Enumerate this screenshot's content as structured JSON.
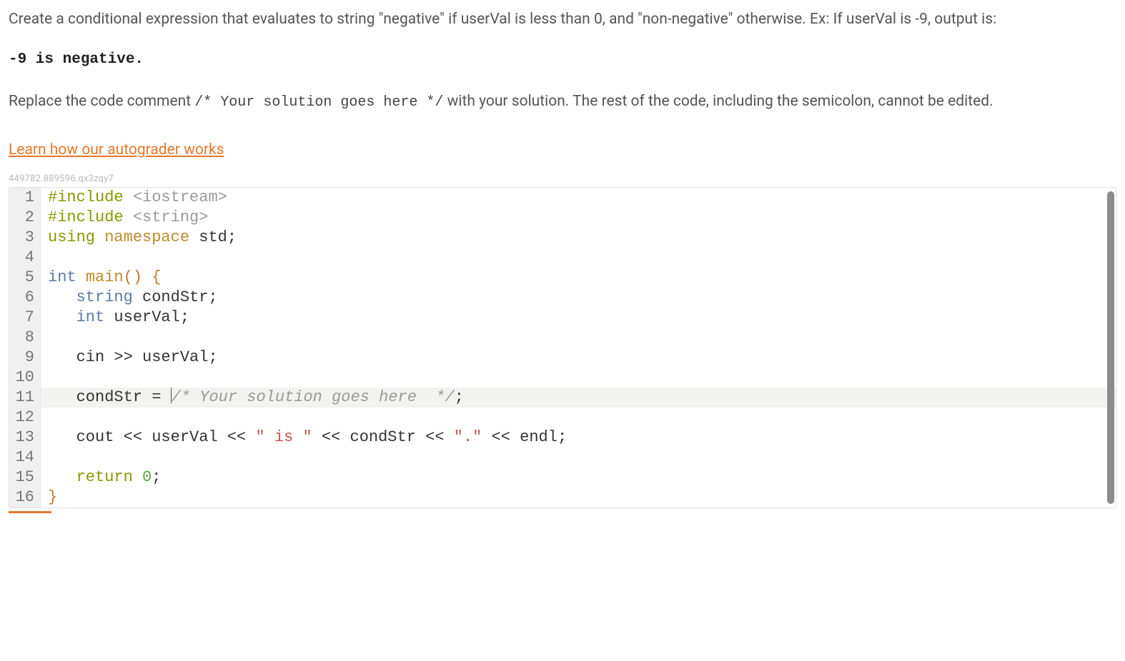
{
  "prompt": {
    "p1a": "Create a conditional expression that evaluates to string \"negative\" if userVal is less than 0, and \"non-negative\" otherwise. Ex: If userVal is -9, output is:",
    "sample": "-9 is negative.",
    "p2a": "Replace the code comment ",
    "p2code": "/* Your solution goes here */",
    "p2b": " with your solution. The rest of the code, including the semicolon, cannot be edited."
  },
  "link": {
    "label": "Learn how our autograder works"
  },
  "session_id": "449782.889596.qx3zqy7",
  "editor": {
    "highlight_line": 11,
    "lines": [
      {
        "n": 1,
        "tokens": [
          [
            "kw-pp",
            "#include "
          ],
          [
            "kw-inc",
            "<iostream>"
          ]
        ]
      },
      {
        "n": 2,
        "tokens": [
          [
            "kw-pp",
            "#include "
          ],
          [
            "kw-inc",
            "<string>"
          ]
        ]
      },
      {
        "n": 3,
        "tokens": [
          [
            "kw-pp",
            "using "
          ],
          [
            "kw-ns",
            "namespace "
          ],
          [
            "kw-id",
            "std"
          ],
          [
            "punct",
            ";"
          ]
        ]
      },
      {
        "n": 4,
        "tokens": [
          [
            "",
            ""
          ]
        ]
      },
      {
        "n": 5,
        "tokens": [
          [
            "kw-type",
            "int "
          ],
          [
            "kw-min",
            "main"
          ],
          [
            "paren",
            "()"
          ],
          [
            "",
            " "
          ],
          [
            "brace",
            "{"
          ]
        ]
      },
      {
        "n": 6,
        "tokens": [
          [
            "",
            "   "
          ],
          [
            "kw-str",
            "string "
          ],
          [
            "kw-id",
            "condStr"
          ],
          [
            "punct",
            ";"
          ]
        ]
      },
      {
        "n": 7,
        "tokens": [
          [
            "",
            "   "
          ],
          [
            "kw-type",
            "int "
          ],
          [
            "kw-id",
            "userVal"
          ],
          [
            "punct",
            ";"
          ]
        ]
      },
      {
        "n": 8,
        "tokens": [
          [
            "",
            ""
          ]
        ]
      },
      {
        "n": 9,
        "tokens": [
          [
            "",
            "   "
          ],
          [
            "kw-id",
            "cin "
          ],
          [
            "kw-op",
            ">> "
          ],
          [
            "kw-id",
            "userVal"
          ],
          [
            "punct",
            ";"
          ]
        ]
      },
      {
        "n": 10,
        "tokens": [
          [
            "",
            ""
          ]
        ]
      },
      {
        "n": 11,
        "tokens": [
          [
            "",
            "   "
          ],
          [
            "kw-id",
            "condStr "
          ],
          [
            "kw-op",
            "= "
          ],
          [
            "caret",
            ""
          ],
          [
            "kw-cmt",
            "/* Your solution goes here  */"
          ],
          [
            "punct",
            ";"
          ]
        ]
      },
      {
        "n": 12,
        "tokens": [
          [
            "",
            ""
          ]
        ]
      },
      {
        "n": 13,
        "tokens": [
          [
            "",
            "   "
          ],
          [
            "kw-id",
            "cout "
          ],
          [
            "kw-op",
            "<< "
          ],
          [
            "kw-id",
            "userVal "
          ],
          [
            "kw-op",
            "<< "
          ],
          [
            "kw-str2",
            "\" is \""
          ],
          [
            "",
            " "
          ],
          [
            "kw-op",
            "<< "
          ],
          [
            "kw-id",
            "condStr "
          ],
          [
            "kw-op",
            "<< "
          ],
          [
            "kw-str2",
            "\".\""
          ],
          [
            "",
            " "
          ],
          [
            "kw-op",
            "<< "
          ],
          [
            "kw-id",
            "endl"
          ],
          [
            "punct",
            ";"
          ]
        ]
      },
      {
        "n": 14,
        "tokens": [
          [
            "",
            ""
          ]
        ]
      },
      {
        "n": 15,
        "tokens": [
          [
            "",
            "   "
          ],
          [
            "kw-ret",
            "return "
          ],
          [
            "kw-num",
            "0"
          ],
          [
            "punct",
            ";"
          ]
        ]
      },
      {
        "n": 16,
        "tokens": [
          [
            "brace",
            "}"
          ]
        ]
      }
    ]
  }
}
